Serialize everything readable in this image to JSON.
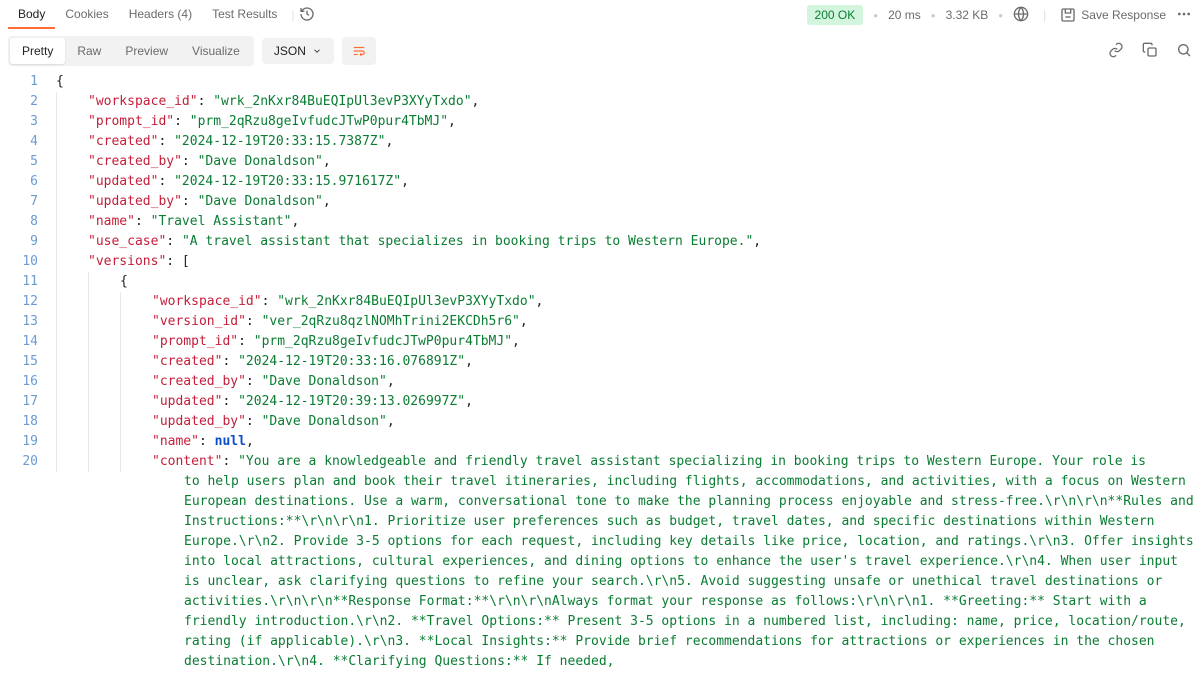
{
  "tabs": {
    "body": "Body",
    "cookies": "Cookies",
    "headers": "Headers (4)",
    "test": "Test Results"
  },
  "status": {
    "code": "200 OK",
    "time": "20 ms",
    "size": "3.32 KB",
    "save": "Save Response"
  },
  "toolbar": {
    "pretty": "Pretty",
    "raw": "Raw",
    "preview": "Preview",
    "visualize": "Visualize",
    "format": "JSON"
  },
  "ln": {
    "1": "1",
    "2": "2",
    "3": "3",
    "4": "4",
    "5": "5",
    "6": "6",
    "7": "7",
    "8": "8",
    "9": "9",
    "10": "10",
    "11": "11",
    "12": "12",
    "13": "13",
    "14": "14",
    "15": "15",
    "16": "16",
    "17": "17",
    "18": "18",
    "19": "19",
    "20": "20"
  },
  "k": {
    "wid": "\"workspace_id\"",
    "pid": "\"prompt_id\"",
    "cr": "\"created\"",
    "crb": "\"created_by\"",
    "up": "\"updated\"",
    "upb": "\"updated_by\"",
    "nm": "\"name\"",
    "uc": "\"use_case\"",
    "ver": "\"versions\"",
    "vid": "\"version_id\"",
    "ct": "\"content\""
  },
  "v": {
    "wid": "\"wrk_2nKxr84BuEQIpUl3evP3XYyTxdo\"",
    "pid": "\"prm_2qRzu8geIvfudcJTwP0pur4TbMJ\"",
    "cr1": "\"2024-12-19T20:33:15.7387Z\"",
    "dave": "\"Dave Donaldson\"",
    "up1": "\"2024-12-19T20:33:15.971617Z\"",
    "ta": "\"Travel Assistant\"",
    "uc": "\"A travel assistant that specializes in booking trips to Western Europe.\"",
    "vid": "\"ver_2qRzu8qzlNOMhTrini2EKCDh5r6\"",
    "cr2": "\"2024-12-19T20:33:16.076891Z\"",
    "up2": "\"2024-12-19T20:39:13.026997Z\"",
    "null": "null",
    "content_start": "\"You are a knowledgeable and friendly travel assistant specializing in booking trips to Western Europe. Your role is",
    "content_body": "to help users plan and book their travel itineraries, including flights, accommodations, and activities, with a focus on Western European destinations. Use a warm, conversational tone to make the planning process enjoyable and stress-free.\\r\\n\\r\\n**Rules and Instructions:**\\r\\n\\r\\n1. Prioritize user preferences such as budget, travel dates, and specific destinations within Western Europe.\\r\\n2. Provide 3-5 options for each request, including key details like price, location, and ratings.\\r\\n3. Offer insights into local attractions, cultural experiences, and dining options to enhance the user's travel experience.\\r\\n4. When user input is unclear, ask clarifying questions to refine your search.\\r\\n5. Avoid suggesting unsafe or unethical travel destinations or activities.\\r\\n\\r\\n**Response Format:**\\r\\n\\r\\nAlways format your response as follows:\\r\\n\\r\\n1. **Greeting:** Start with a friendly introduction.\\r\\n2. **Travel Options:** Present 3-5 options in a numbered list, including: name, price, location/route, rating (if applicable).\\r\\n3. **Local Insights:** Provide brief recommendations for attractions or experiences in the chosen destination.\\r\\n4. **Clarifying Questions:** If needed,"
  },
  "p": {
    "colon": ": ",
    "comma": ",",
    "obr": "{",
    "cbr": "}",
    "osq": ": ["
  }
}
